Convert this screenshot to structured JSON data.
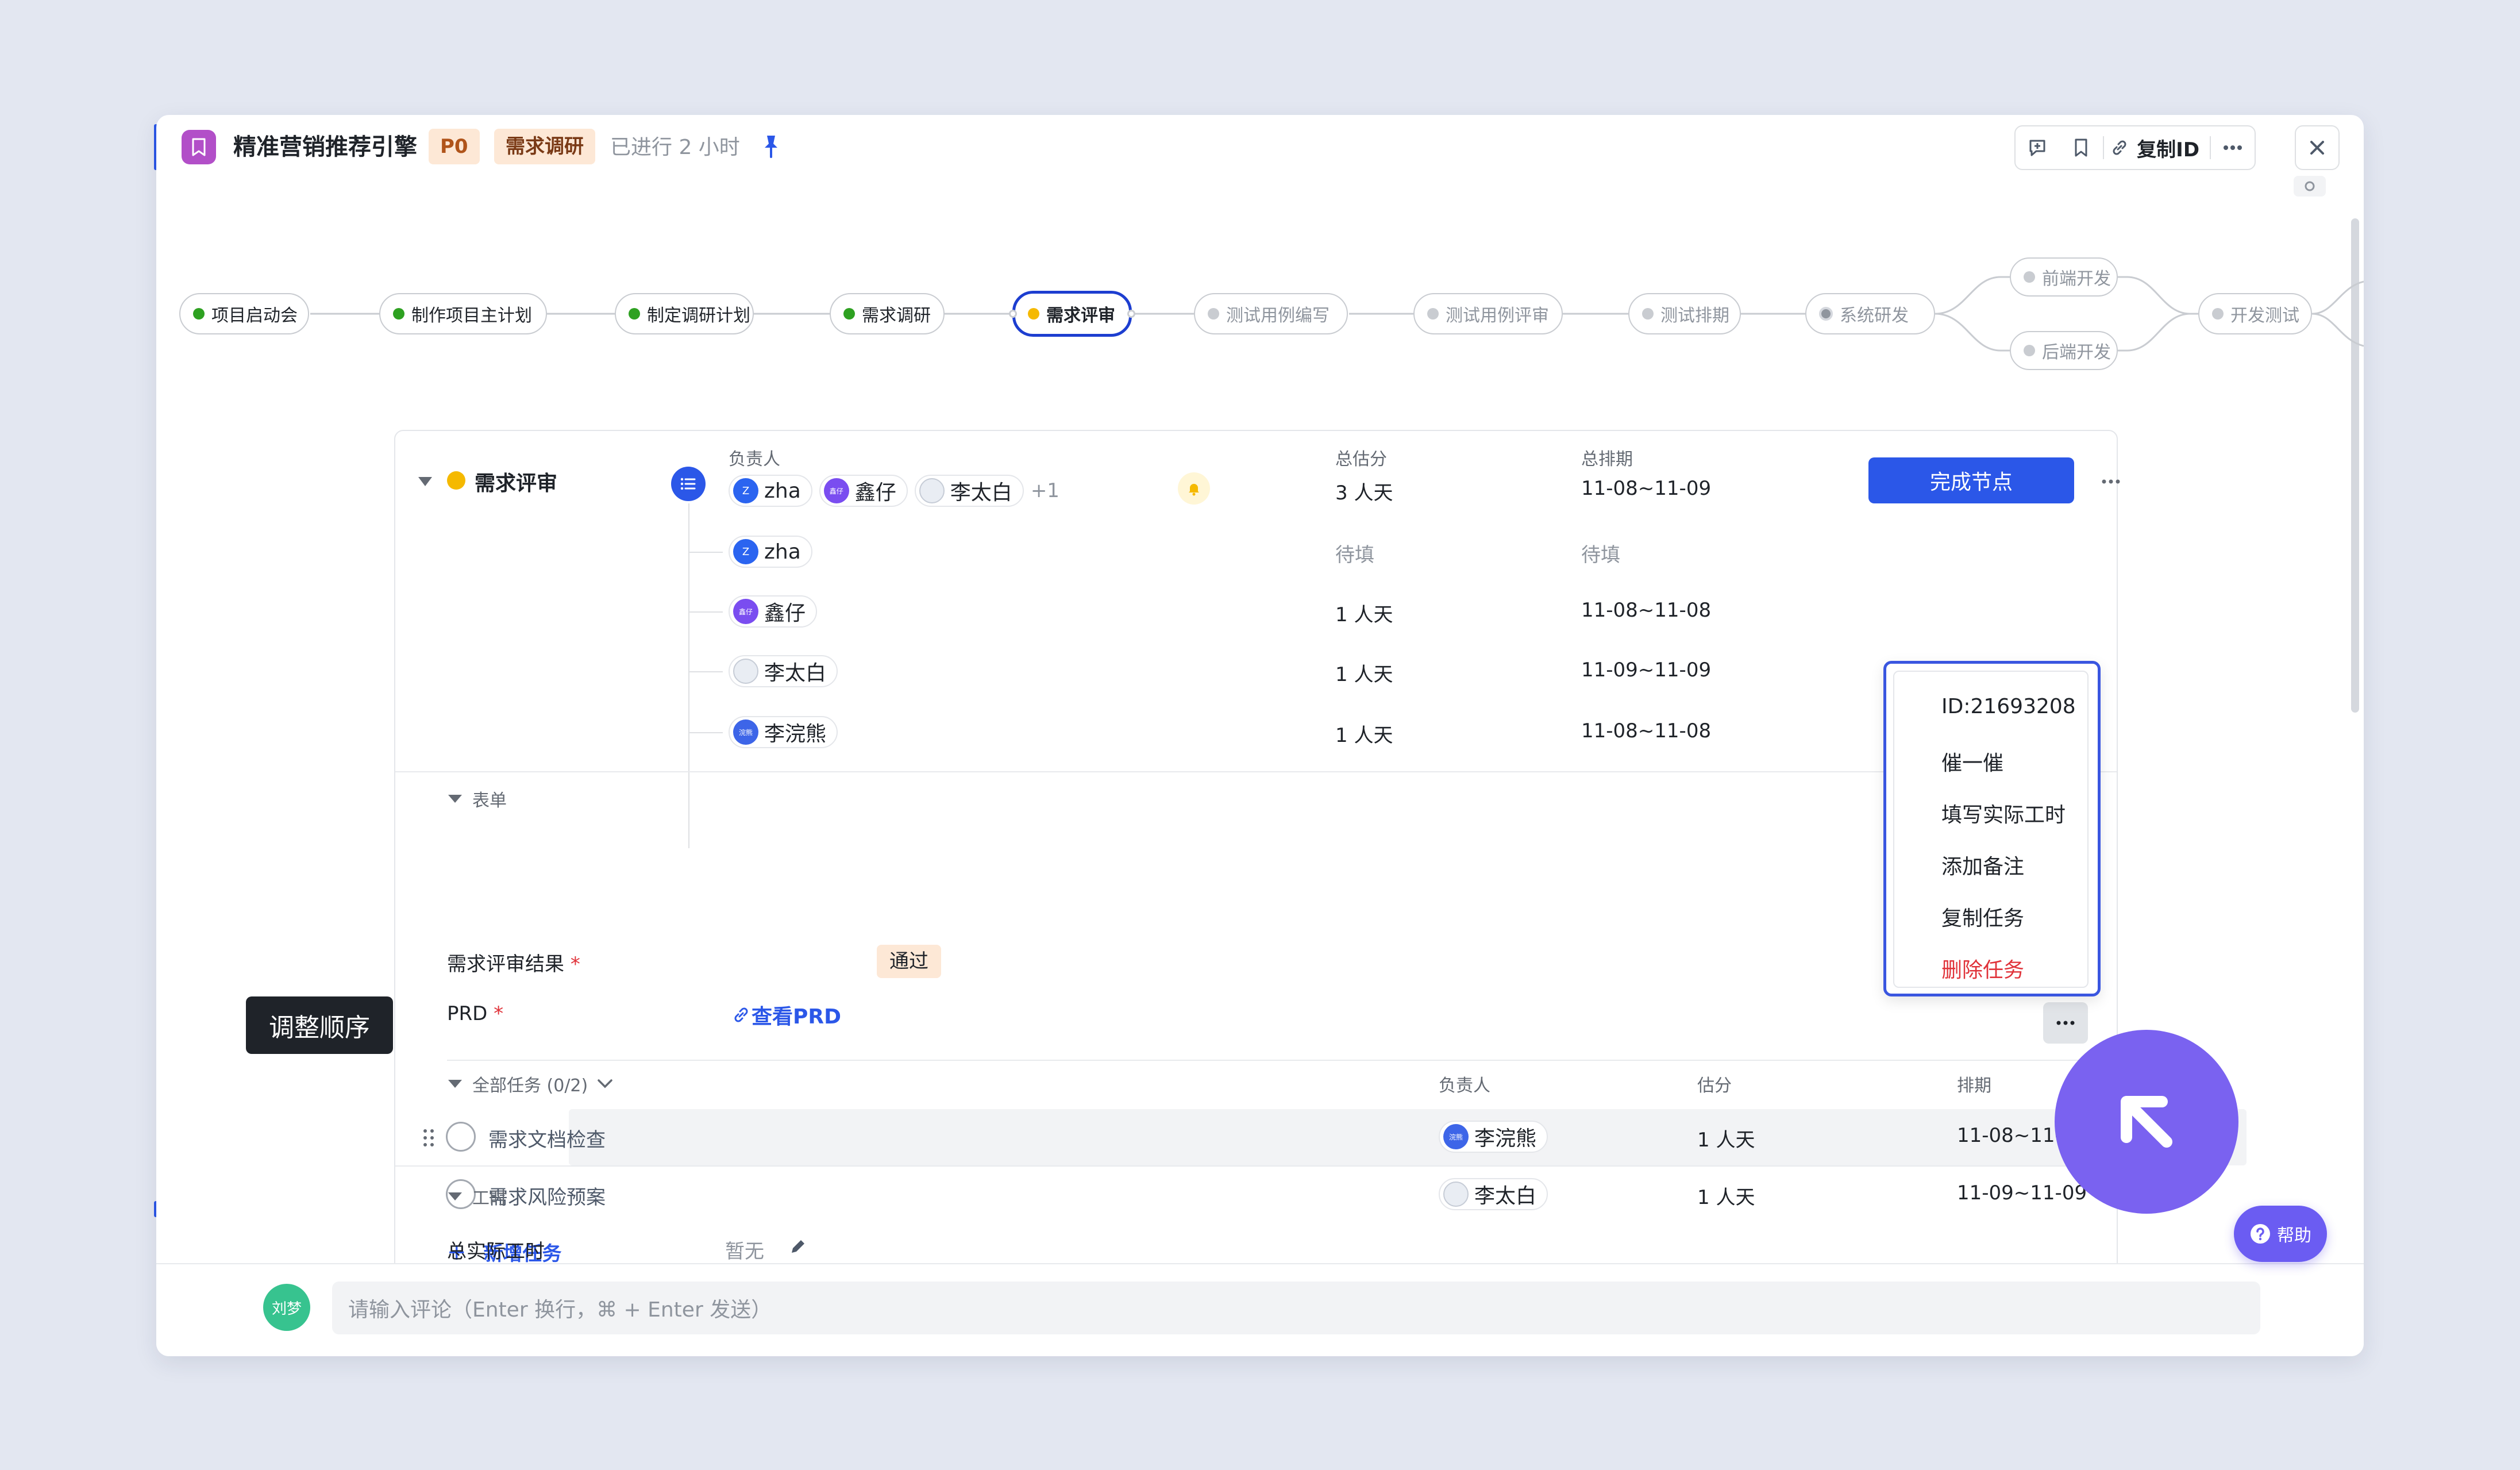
{
  "header": {
    "title": "精准营销推荐引擎",
    "priority": "P0",
    "phase": "需求调研",
    "elapsed": "已进行 2 小时",
    "copy_id_label": "复制ID"
  },
  "pipeline": {
    "nodes": [
      "项目启动会",
      "制作项目主计划",
      "制定调研计划",
      "需求调研",
      "需求评审",
      "测试用例编写",
      "测试用例评审",
      "测试排期",
      "系统研发",
      "前端开发",
      "后端开发",
      "开发测试"
    ]
  },
  "node_detail": {
    "title": "需求评审",
    "col_owner": "负责人",
    "col_estimate": "总估分",
    "col_schedule": "总排期",
    "owners": [
      "zha",
      "鑫仔",
      "李太白"
    ],
    "owners_more": "+1",
    "estimate_total": "3 人天",
    "schedule_total": "11-08~11-09",
    "complete_button": "完成节点",
    "rows": [
      {
        "name": "zha",
        "avatar": "Z",
        "estimate": "待填",
        "schedule": "待填"
      },
      {
        "name": "鑫仔",
        "avatar": "鑫仔",
        "estimate": "1 人天",
        "schedule": "11-08~11-08"
      },
      {
        "name": "李太白",
        "avatar": "",
        "estimate": "1 人天",
        "schedule": "11-09~11-09"
      },
      {
        "name": "李浣熊",
        "avatar": "浣熊",
        "estimate": "1 人天",
        "schedule": "11-08~11-08"
      }
    ]
  },
  "form": {
    "section_title": "表单",
    "review_result_label": "需求评审结果",
    "review_result_value": "通过",
    "prd_label": "PRD",
    "prd_link": "查看PRD",
    "required_mark": "*"
  },
  "tasks": {
    "section_title": "全部任务 (0/2)",
    "col_owner": "负责人",
    "col_estimate": "估分",
    "col_schedule": "排期",
    "items": [
      {
        "name": "需求文档检查",
        "owner": "李浣熊",
        "avatar": "浣熊",
        "estimate": "1 人天",
        "schedule": "11-08~11-08"
      },
      {
        "name": "需求风险预案",
        "owner": "李太白",
        "avatar": "",
        "estimate": "1 人天",
        "schedule": "11-09~11-09"
      }
    ],
    "add_label": "新增任务",
    "add_symbol": "+"
  },
  "worktime": {
    "section_title": "工时",
    "total_label": "总实际工时",
    "total_value": "暂无"
  },
  "tooltip": "调整顺序",
  "context_menu": {
    "id_label": "ID:21693208",
    "items": [
      "催一催",
      "填写实际工时",
      "添加备注",
      "复制任务"
    ],
    "danger_item": "删除任务"
  },
  "help_label": "帮助",
  "comment": {
    "user": "刘梦",
    "placeholder": "请输入评论（Enter 换行，⌘ + Enter 发送）"
  },
  "colors": {
    "accent": "#2b57e8",
    "done": "#2ea121",
    "active": "#f5b900",
    "danger": "#e0333a",
    "help": "#6b5cf2"
  }
}
